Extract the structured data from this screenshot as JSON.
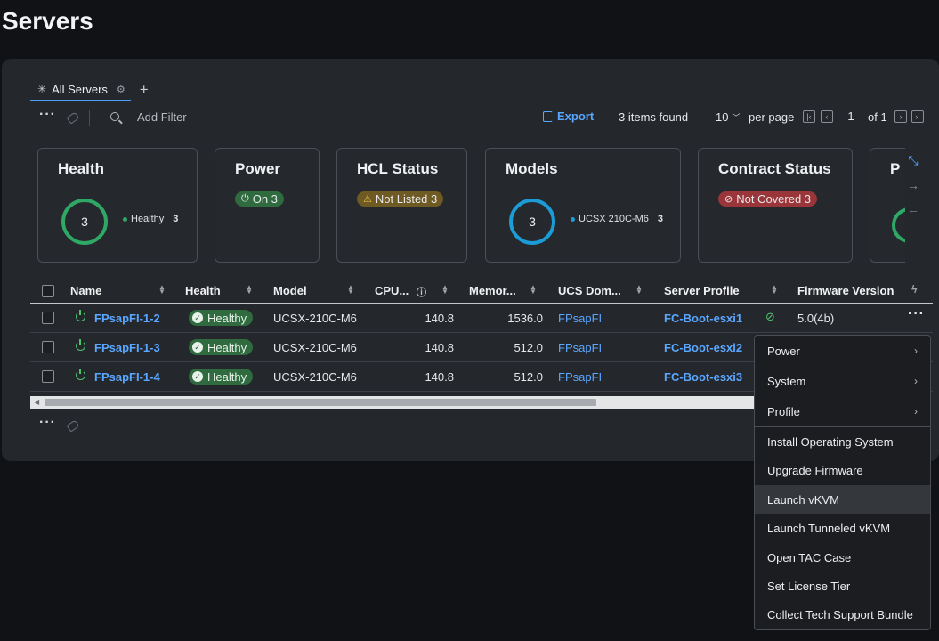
{
  "page": {
    "title": "Servers"
  },
  "tabs": [
    {
      "label": "All Servers",
      "icon": "grid-icon",
      "settings_icon": "gear-icon"
    }
  ],
  "toolbar": {
    "filter_placeholder": "Add Filter",
    "export_label": "Export",
    "items_found": "3 items found",
    "per_page_value": "10",
    "per_page_label": "per page",
    "page_number": "1",
    "page_of": "of 1"
  },
  "cards": {
    "health": {
      "title": "Health",
      "total": "3",
      "legend_label": "Healthy",
      "legend_count": "3",
      "color": "#2fa866"
    },
    "power": {
      "title": "Power",
      "pill": "On 3",
      "color": "#2f6b3e"
    },
    "hcl": {
      "title": "HCL Status",
      "pill": "Not Listed 3",
      "color": "#6e5a22"
    },
    "models": {
      "title": "Models",
      "total": "3",
      "legend_label": "UCSX 210C-M6",
      "legend_count": "3",
      "color": "#1b9cd6"
    },
    "contract": {
      "title": "Contract Status",
      "pill": "Not Covered 3",
      "color": "#9a3539"
    },
    "partial": {
      "title": "P"
    }
  },
  "table": {
    "headers": [
      "Name",
      "Health",
      "Model",
      "CPU...",
      "Memor...",
      "UCS Dom...",
      "Server Profile",
      "Firmware Version"
    ],
    "rows": [
      {
        "name": "FPsapFI-1-2",
        "health": "Healthy",
        "model": "UCSX-210C-M6",
        "cpu": "140.8",
        "memory": "1536.0",
        "domain": "FPsapFI",
        "profile": "FC-Boot-esxi1",
        "firmware": "5.0(4b)"
      },
      {
        "name": "FPsapFI-1-3",
        "health": "Healthy",
        "model": "UCSX-210C-M6",
        "cpu": "140.8",
        "memory": "512.0",
        "domain": "FPsapFI",
        "profile": "FC-Boot-esxi2",
        "firmware": ""
      },
      {
        "name": "FPsapFI-1-4",
        "health": "Healthy",
        "model": "UCSX-210C-M6",
        "cpu": "140.8",
        "memory": "512.0",
        "domain": "FPsapFI",
        "profile": "FC-Boot-esxi3",
        "firmware": ""
      }
    ]
  },
  "context_menu": {
    "items": [
      "Power",
      "System",
      "Profile",
      "Install Operating System",
      "Upgrade Firmware",
      "Launch vKVM",
      "Launch Tunneled vKVM",
      "Open TAC Case",
      "Set License Tier",
      "Collect Tech Support Bundle"
    ],
    "highlighted": "Launch vKVM"
  },
  "colors": {
    "accent": "#5aa7ff",
    "healthy": "#2f6b3e",
    "background": "#101215",
    "panel": "#24272c"
  }
}
